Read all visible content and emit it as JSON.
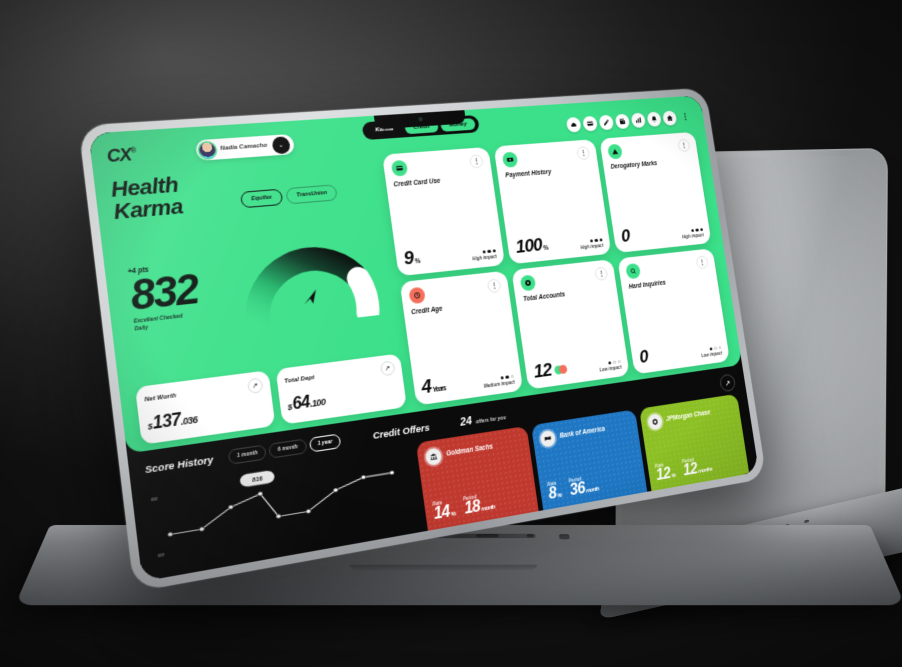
{
  "brand": {
    "logo": "CX",
    "logo_sup": "®"
  },
  "user": {
    "name": "Nadia Camacho",
    "chevron": "⌄"
  },
  "nav": {
    "tabs": [
      {
        "label": "Karma",
        "state": "active"
      },
      {
        "label": "Credit",
        "state": "pill"
      },
      {
        "label": "Money",
        "state": "pill"
      }
    ]
  },
  "toolbar": {
    "icons": [
      "cloud-icon",
      "card-icon",
      "pen-icon",
      "wallet-icon",
      "chart-icon",
      "bell-icon",
      "home-icon"
    ],
    "more": "⋮"
  },
  "hero": {
    "title_line1": "Health",
    "title_line2": "Karma",
    "bureaus": [
      {
        "label": "Equifax",
        "selected": true
      },
      {
        "label": "TransUnion",
        "selected": false
      }
    ],
    "delta": "+4 pts",
    "score": "832",
    "subtitle": "Excellent Checked Daily"
  },
  "mini_cards": [
    {
      "label": "Net Worth",
      "currency": "$",
      "value": "137",
      "decimals": ".036",
      "action": "↗"
    },
    {
      "label": "Total Dept",
      "currency": "$",
      "value": "64",
      "decimals": ".100",
      "action": "↗"
    }
  ],
  "metrics": [
    {
      "name": "Credit Card Use",
      "value": "9",
      "unit": "%",
      "impact": "High impact",
      "impact_level": 3,
      "icon": "card-icon",
      "icon_bg": "#3CE08A",
      "menu": "⋮"
    },
    {
      "name": "Payment History",
      "value": "100",
      "unit": "%",
      "impact": "High impact",
      "impact_level": 3,
      "icon": "cash-icon",
      "icon_bg": "#3CE08A",
      "menu": "⋮"
    },
    {
      "name": "Derogatory Marks",
      "value": "0",
      "unit": "",
      "impact": "High impact",
      "impact_level": 3,
      "icon": "triangle-icon",
      "icon_bg": "#3CE08A",
      "menu": "⋮"
    },
    {
      "name": "Credit Age",
      "value": "4",
      "unit": "Years",
      "impact": "Medium impact",
      "impact_level": 2,
      "icon": "clock-icon",
      "icon_bg": "#F4705C",
      "menu": "⋮"
    },
    {
      "name": "Total Accounts",
      "value": "12",
      "unit": "",
      "impact": "Low impact",
      "impact_level": 1,
      "icon": "stack-icon",
      "icon_bg": "#3CE08A",
      "menu": "⋮"
    },
    {
      "name": "Hard Inquiries",
      "value": "0",
      "unit": "",
      "impact": "Low impact",
      "impact_level": 1,
      "icon": "search-icon",
      "icon_bg": "#3CE08A",
      "menu": "⋮"
    }
  ],
  "score_history": {
    "title": "Score History",
    "ranges": [
      {
        "label": "1 month",
        "selected": false
      },
      {
        "label": "6 month",
        "selected": false
      },
      {
        "label": "1 year",
        "selected": true
      }
    ],
    "callout": "816"
  },
  "credit_offers": {
    "title": "Credit Offers",
    "count": "24",
    "count_label": "offers for you",
    "expand": "↗",
    "rate_label": "Rate",
    "period_label": "Period",
    "items": [
      {
        "bank": "Goldman Sachs",
        "color": "#C0392F",
        "icon": "bank-icon",
        "rate": "14",
        "rate_unit": "%",
        "period": "18",
        "period_unit": "month"
      },
      {
        "bank": "Bank of America",
        "color": "#1F77C4",
        "icon": "flag-icon",
        "rate": "8",
        "rate_unit": "%",
        "period": "36",
        "period_unit": "month"
      },
      {
        "bank": "JPMorgan Chase",
        "color": "#8CC024",
        "icon": "chase-icon",
        "rate": "12",
        "rate_unit": "%",
        "period": "12",
        "period_unit": "months"
      }
    ]
  },
  "chart_data": {
    "type": "line",
    "title": "Score History",
    "x": [
      0,
      1,
      2,
      3,
      4,
      5,
      6,
      7,
      8
    ],
    "values": [
      780,
      781,
      800,
      816,
      790,
      790,
      800,
      820,
      820
    ],
    "categories": [
      "",
      "",
      "",
      "",
      "",
      "",
      "",
      "",
      ""
    ],
    "ytick_labels": [
      "850",
      "600"
    ],
    "ylim": [
      600,
      850
    ],
    "xlabel": "",
    "ylabel": "",
    "grid": false,
    "legend": "none",
    "annotation": "816",
    "line_color": "#ffffff",
    "point_color": "#ffffff"
  },
  "colors": {
    "accent_green": "#3CE08A",
    "dark": "#0b0b0b",
    "card_white": "#ffffff",
    "warn_red": "#F4705C"
  }
}
